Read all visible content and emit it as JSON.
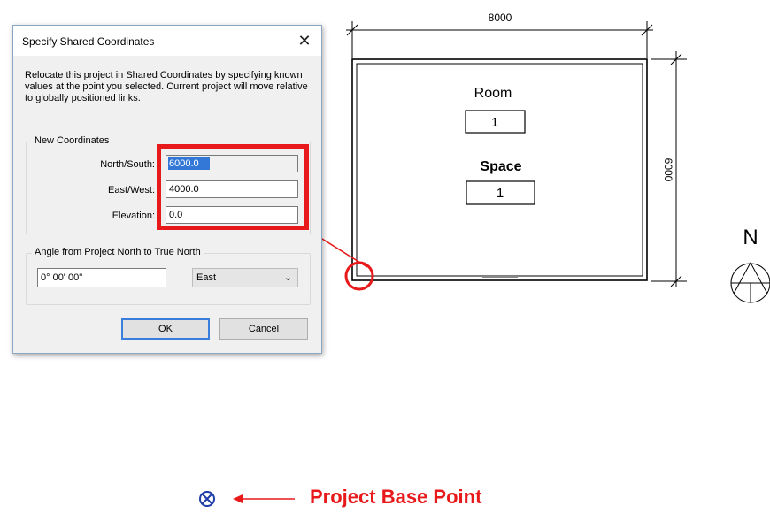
{
  "drawing": {
    "dim_width": "8000",
    "dim_height": "6000",
    "room_label": "Room",
    "room_number": "1",
    "space_label": "Space",
    "space_number": "1",
    "north_label": "N"
  },
  "dialog": {
    "title": "Specify Shared Coordinates",
    "close_glyph": "✕",
    "description": "Relocate this project in Shared Coordinates by specifying known values at the point you selected. Current project will move relative to globally positioned links.",
    "new_coords_legend": "New Coordinates",
    "north_south_label": "North/South:",
    "north_south_value": "6000.0",
    "east_west_label": "East/West:",
    "east_west_value": "4000.0",
    "elevation_label": "Elevation:",
    "elevation_value": "0.0",
    "angle_legend": "Angle from Project North to True North",
    "angle_value": "0° 00' 00\"",
    "direction_value": "East",
    "ok_label": "OK",
    "cancel_label": "Cancel"
  },
  "annotation": {
    "base_point_label": "Project Base Point",
    "highlight_color": "#e8191b"
  },
  "icons": {
    "base_point": "circle-x-icon",
    "north_arrow": "north-arrow-icon",
    "close": "close-icon",
    "dropdown": "chevron-down-icon"
  }
}
